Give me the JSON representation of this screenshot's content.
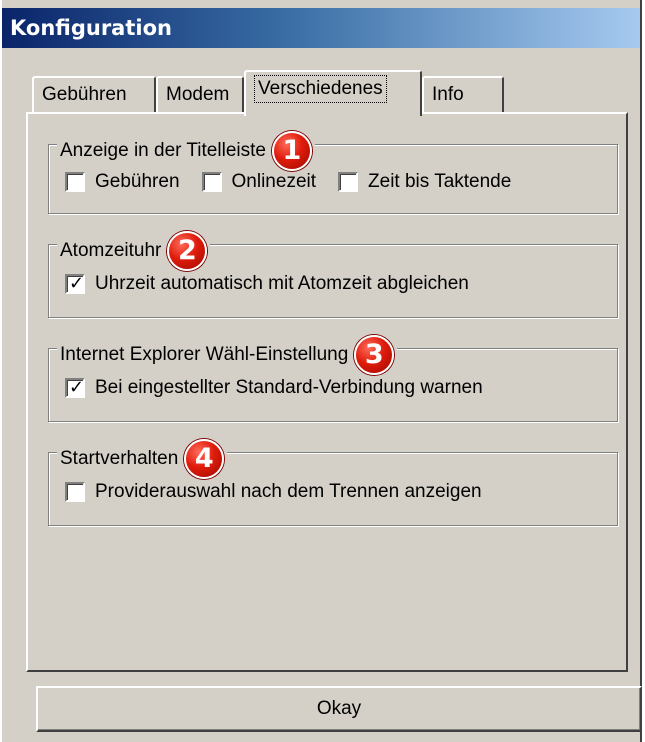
{
  "window": {
    "title": "Konfiguration"
  },
  "tabs": [
    {
      "label": "Gebühren",
      "active": false
    },
    {
      "label": "Modem",
      "active": false
    },
    {
      "label": "Verschiedenes",
      "active": true
    },
    {
      "label": "Info",
      "active": false
    }
  ],
  "groups": {
    "titlebar": {
      "legend": "Anzeige in der Titelleiste",
      "badge": "1",
      "options": [
        {
          "label": "Gebühren",
          "checked": false
        },
        {
          "label": "Onlinezeit",
          "checked": false
        },
        {
          "label": "Zeit bis Taktende",
          "checked": false
        }
      ]
    },
    "atomic_clock": {
      "legend": "Atomzeituhr",
      "badge": "2",
      "options": [
        {
          "label": "Uhrzeit automatisch mit Atomzeit abgleichen",
          "checked": true
        }
      ]
    },
    "ie_dial": {
      "legend": "Internet Explorer Wähl-Einstellung",
      "badge": "3",
      "options": [
        {
          "label": "Bei eingestellter Standard-Verbindung warnen",
          "checked": true
        }
      ]
    },
    "startup": {
      "legend": "Startverhalten",
      "badge": "4",
      "options": [
        {
          "label": "Providerauswahl nach dem Trennen anzeigen",
          "checked": false
        }
      ]
    }
  },
  "footer": {
    "ok_label": "Okay"
  },
  "colors": {
    "dialog_face": "#d4d0c8",
    "titlebar_start": "#0a246a",
    "titlebar_end": "#a6caf0",
    "badge": "#e01c0c"
  },
  "icons": {
    "check": "checkmark-icon",
    "badge": "numbered-circle-badge"
  }
}
